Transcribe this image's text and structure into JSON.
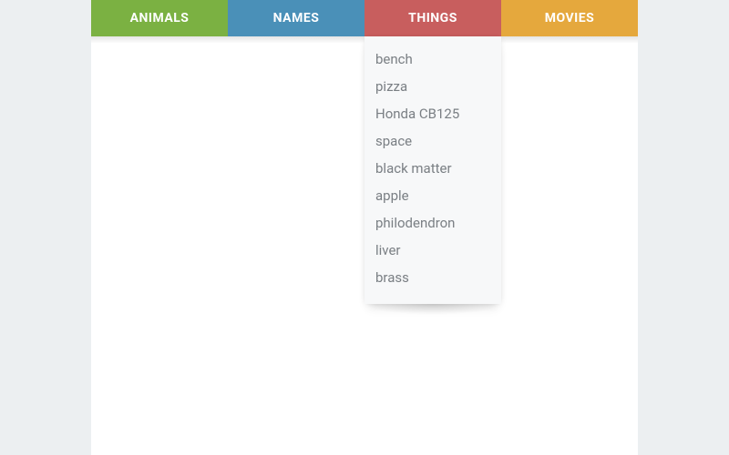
{
  "tabs": [
    {
      "label": "ANIMALS",
      "class": "animals"
    },
    {
      "label": "NAMES",
      "class": "names"
    },
    {
      "label": "THINGS",
      "class": "things"
    },
    {
      "label": "MOVIES",
      "class": "movies"
    }
  ],
  "active_tab_index": 2,
  "dropdown_items": [
    "bench",
    "pizza",
    "Honda CB125",
    "space",
    "black matter",
    "apple",
    "philodendron",
    "liver",
    "brass"
  ]
}
